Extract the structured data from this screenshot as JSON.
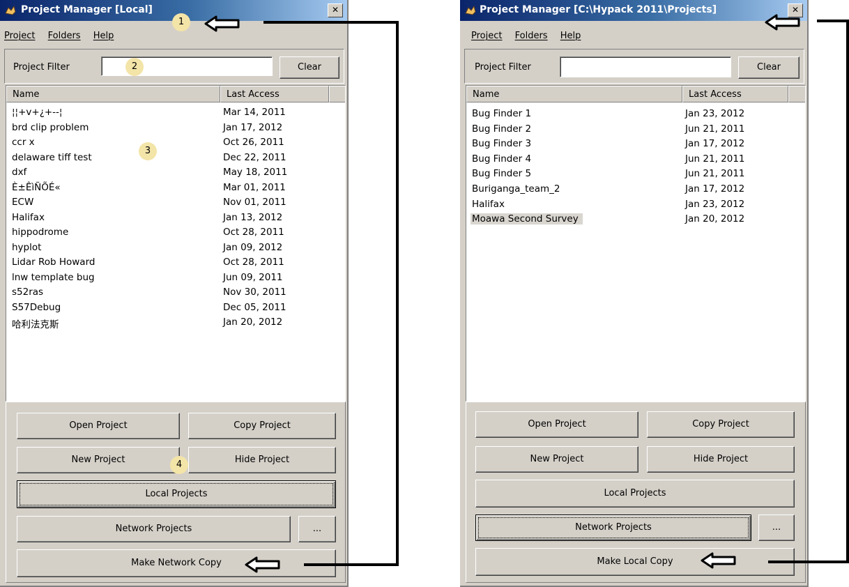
{
  "left_window": {
    "title": "Project Manager [Local]",
    "menu": [
      "Project",
      "Folders",
      "Help"
    ],
    "filter_label": "Project Filter",
    "filter_value": "",
    "clear_label": "Clear",
    "columns": [
      "Name",
      "Last Access"
    ],
    "rows": [
      {
        "name": "¦¦+v+¿+--¦",
        "date": "Mar 14, 2011"
      },
      {
        "name": "brd clip problem",
        "date": "Jan 17, 2012"
      },
      {
        "name": "ccr x",
        "date": "Oct 26, 2011"
      },
      {
        "name": "delaware tiff test",
        "date": "Dec 22, 2011"
      },
      {
        "name": "dxf",
        "date": "May 18, 2011"
      },
      {
        "name": "È±ÊìÑÕÉ«",
        "date": "Mar 01, 2011"
      },
      {
        "name": "ECW",
        "date": "Nov 01, 2011"
      },
      {
        "name": "Halifax",
        "date": "Jan 13, 2012"
      },
      {
        "name": "hippodrome",
        "date": "Oct 28, 2011"
      },
      {
        "name": "hyplot",
        "date": "Jan 09, 2012"
      },
      {
        "name": "Lidar Rob Howard",
        "date": "Oct 28, 2011"
      },
      {
        "name": "lnw template bug",
        "date": "Jun 09, 2011"
      },
      {
        "name": "s52ras",
        "date": "Nov 30, 2011"
      },
      {
        "name": "S57Debug",
        "date": "Dec 05, 2011"
      },
      {
        "name": "哈利法克斯",
        "date": "Jan 20, 2012"
      }
    ],
    "buttons": {
      "open": "Open Project",
      "copy": "Copy Project",
      "new": "New Project",
      "hide": "Hide Project",
      "local": "Local Projects",
      "network": "Network Projects",
      "more": "...",
      "make_copy": "Make Network Copy"
    },
    "badges": [
      "1",
      "2",
      "3",
      "4"
    ]
  },
  "right_window": {
    "title": "Project Manager [C:\\Hypack 2011\\Projects]",
    "menu": [
      "Project",
      "Folders",
      "Help"
    ],
    "filter_label": "Project Filter",
    "filter_value": "",
    "clear_label": "Clear",
    "columns": [
      "Name",
      "Last Access"
    ],
    "rows": [
      {
        "name": "Bug Finder 1",
        "date": "Jan 23, 2012"
      },
      {
        "name": "Bug Finder 2",
        "date": "Jun 21, 2011"
      },
      {
        "name": "Bug Finder 3",
        "date": "Jan 17, 2012"
      },
      {
        "name": "Bug Finder 4",
        "date": "Jun 21, 2011"
      },
      {
        "name": "Bug Finder 5",
        "date": "Jun 21, 2011"
      },
      {
        "name": "Buriganga_team_2",
        "date": "Jan 17, 2012"
      },
      {
        "name": "Halifax",
        "date": "Jan 23, 2012"
      },
      {
        "name": "Moawa Second Survey",
        "date": "Jan 20, 2012"
      }
    ],
    "selected_row": "Moawa Second Survey",
    "buttons": {
      "open": "Open Project",
      "copy": "Copy Project",
      "new": "New Project",
      "hide": "Hide Project",
      "local": "Local Projects",
      "network": "Network Projects",
      "more": "...",
      "make_copy": "Make Local Copy"
    }
  },
  "colors": {
    "titlebar_start": "#0a246a",
    "titlebar_end": "#a6caf0",
    "face": "#d4d0c8",
    "badge": "#f3e4a8"
  },
  "icons": [
    "app-icon",
    "close-icon",
    "left-arrow-icon"
  ]
}
